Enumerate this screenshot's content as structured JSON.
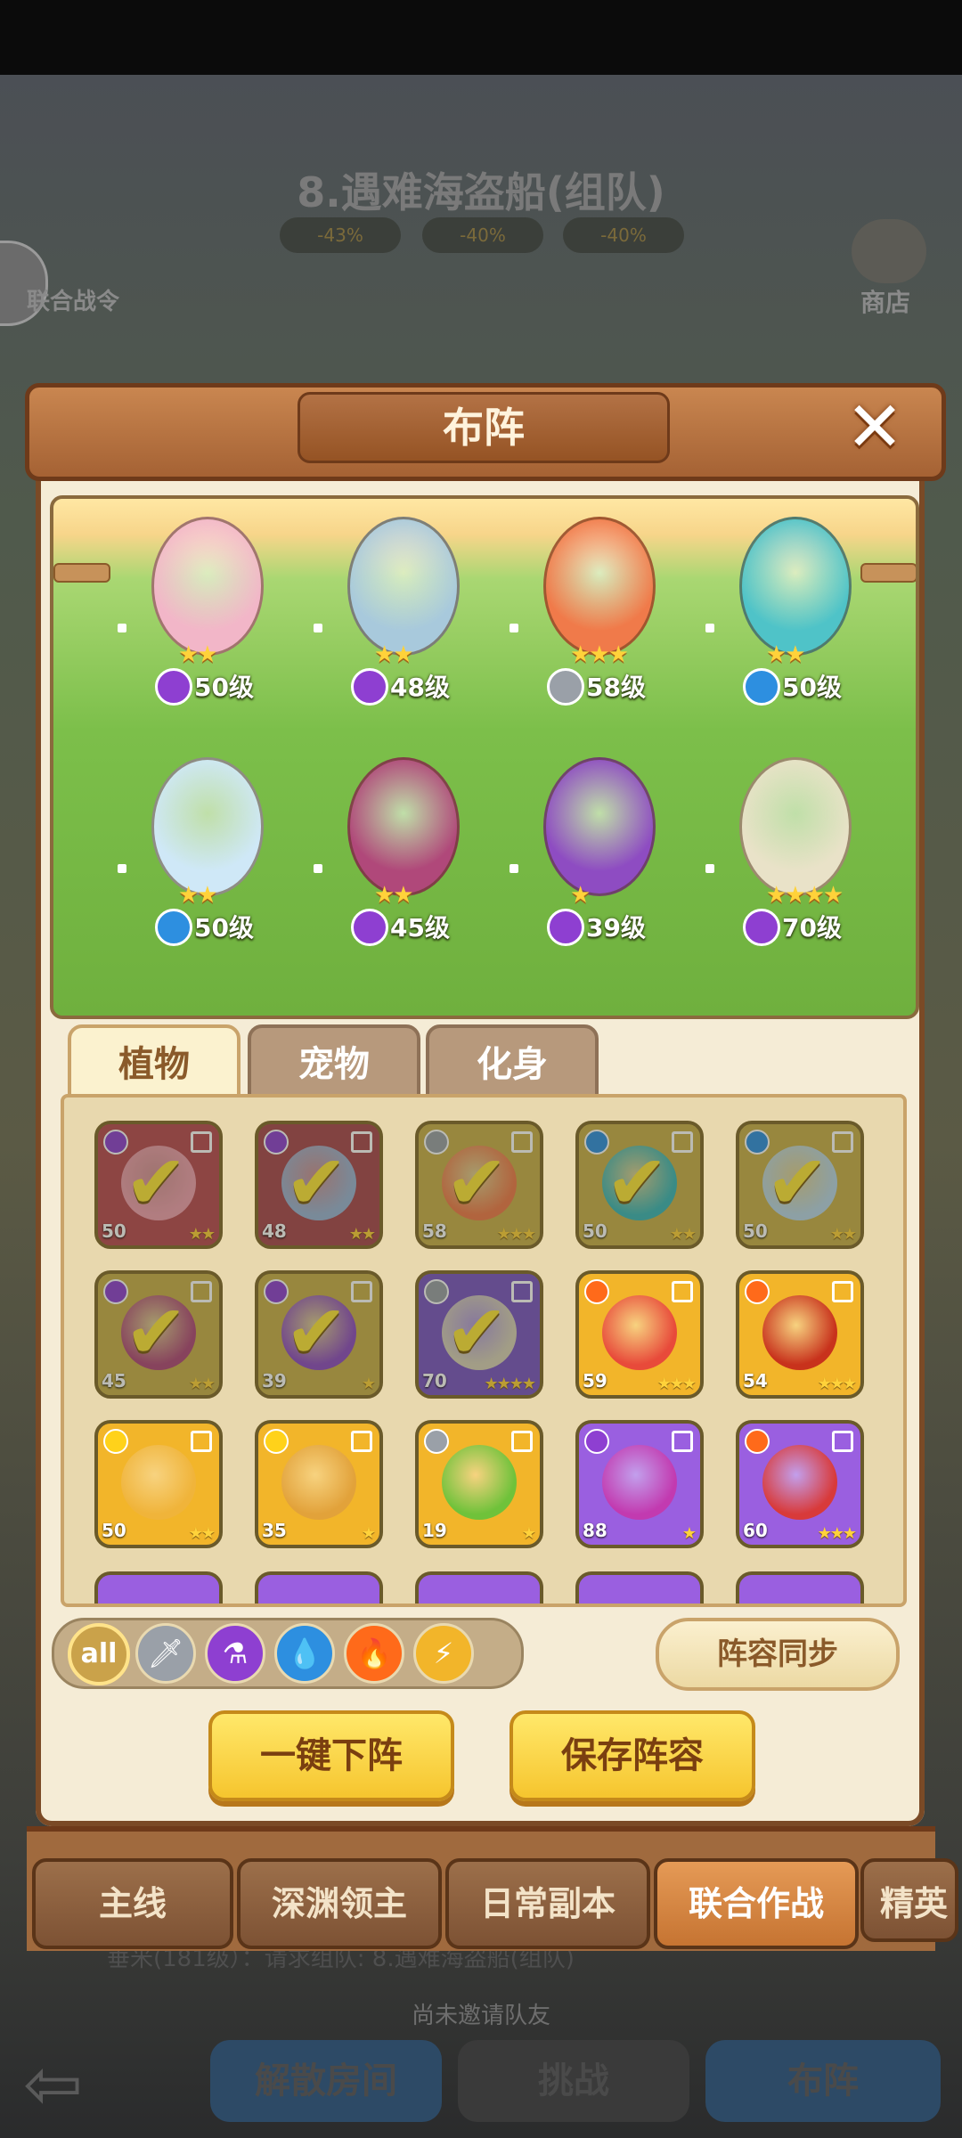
{
  "background": {
    "stage_title": "8.遇难海盗船(组队)",
    "stat_pills": [
      "-43%",
      "-40%",
      "-40%"
    ],
    "left_side_label": "联合战令",
    "right_side_label": "商店",
    "sub_text": "垂米(181级）：请求组队: 8.遇难海盗船(组队)",
    "invite_status": "尚未邀请队友",
    "buttons": [
      "解散房间",
      "挑战",
      "布阵"
    ]
  },
  "panel": {
    "title": "布阵",
    "close_icon": "close-icon"
  },
  "formation": [
    {
      "level": "50级",
      "stars": "★★",
      "element": "poison",
      "color": "#f2b6c8"
    },
    {
      "level": "48级",
      "stars": "★★",
      "element": "poison",
      "color": "#a8c9dc"
    },
    {
      "level": "58级",
      "stars": "★★★",
      "element": "sword",
      "color": "#f07a4a"
    },
    {
      "level": "50级",
      "stars": "★★",
      "element": "water",
      "color": "#4fc3c8"
    },
    {
      "level": "50级",
      "stars": "★★",
      "element": "water",
      "color": "#cfe8f7"
    },
    {
      "level": "45级",
      "stars": "★★",
      "element": "poison",
      "color": "#b0487a"
    },
    {
      "level": "39级",
      "stars": "★",
      "element": "poison",
      "color": "#8e4cc2"
    },
    {
      "level": "70级",
      "stars": "★★★★",
      "element": "poison",
      "color": "#e9e2c8"
    }
  ],
  "tabs": [
    "植物",
    "宠物",
    "化身"
  ],
  "cards": [
    {
      "level": "50",
      "stars": "★★",
      "checked": true,
      "bg": "#b84a52",
      "face": "#f0a0b0",
      "elem": "#8e3fd1"
    },
    {
      "level": "48",
      "stars": "★★",
      "checked": true,
      "bg": "#a8474f",
      "face": "#9ab4d6",
      "elem": "#8e3fd1"
    },
    {
      "level": "58",
      "stars": "★★★",
      "checked": true,
      "bg": "#c9b04a",
      "face": "#f07a4a",
      "elem": "#9aa0a8"
    },
    {
      "level": "50",
      "stars": "★★",
      "checked": true,
      "bg": "#c9b04a",
      "face": "#39b6b8",
      "elem": "#2d8fe0"
    },
    {
      "level": "50",
      "stars": "★★",
      "checked": true,
      "bg": "#c9b04a",
      "face": "#b8d6e8",
      "elem": "#2d8fe0"
    },
    {
      "level": "45",
      "stars": "★★",
      "checked": true,
      "bg": "#c9b04a",
      "face": "#b0487a",
      "elem": "#8e3fd1"
    },
    {
      "level": "39",
      "stars": "★",
      "checked": true,
      "bg": "#c9b04a",
      "face": "#8e4cc2",
      "elem": "#8e3fd1"
    },
    {
      "level": "70",
      "stars": "★★★★",
      "checked": true,
      "bg": "#7a55c4",
      "face": "#d9d2b8",
      "elem": "#9aa0a8"
    },
    {
      "level": "59",
      "stars": "★★★",
      "checked": false,
      "bg": "#f2b52a",
      "face": "#e84a3a",
      "elem": "#ff6a1a"
    },
    {
      "level": "54",
      "stars": "★★★",
      "checked": false,
      "bg": "#f2b52a",
      "face": "#c8321c",
      "elem": "#ff6a1a"
    },
    {
      "level": "50",
      "stars": "★★",
      "checked": false,
      "bg": "#f2b52a",
      "face": "#f0b43a",
      "elem": "#ffd21a"
    },
    {
      "level": "35",
      "stars": "★",
      "checked": false,
      "bg": "#f2b52a",
      "face": "#e2a23a",
      "elem": "#ffd21a"
    },
    {
      "level": "19",
      "stars": "★",
      "checked": false,
      "bg": "#f2b52a",
      "face": "#6fc23a",
      "elem": "#9aa0a8"
    },
    {
      "level": "88",
      "stars": "★",
      "checked": false,
      "bg": "#9a5fe0",
      "face": "#c23ab0",
      "elem": "#8e3fd1"
    },
    {
      "level": "60",
      "stars": "★★★",
      "checked": false,
      "bg": "#9a5fe0",
      "face": "#d83a3a",
      "elem": "#ff6a1a"
    }
  ],
  "filters": {
    "all_label": "all",
    "items": [
      {
        "name": "sword-filter-icon",
        "glyph": "🗡",
        "color": "#9aa0a8"
      },
      {
        "name": "poison-filter-icon",
        "glyph": "⚗",
        "color": "#8e3fd1"
      },
      {
        "name": "water-filter-icon",
        "glyph": "💧",
        "color": "#2d8fe0"
      },
      {
        "name": "fire-filter-icon",
        "glyph": "🔥",
        "color": "#ff6a1a"
      },
      {
        "name": "lightning-filter-icon",
        "glyph": "⚡",
        "color": "#f2b52a"
      }
    ]
  },
  "actions": {
    "sync": "阵容同步",
    "unequip": "一键下阵",
    "save": "保存阵容"
  },
  "mode_tabs": [
    "主线",
    "深渊领主",
    "日常副本",
    "联合作战",
    "精英"
  ],
  "active_mode": 3
}
